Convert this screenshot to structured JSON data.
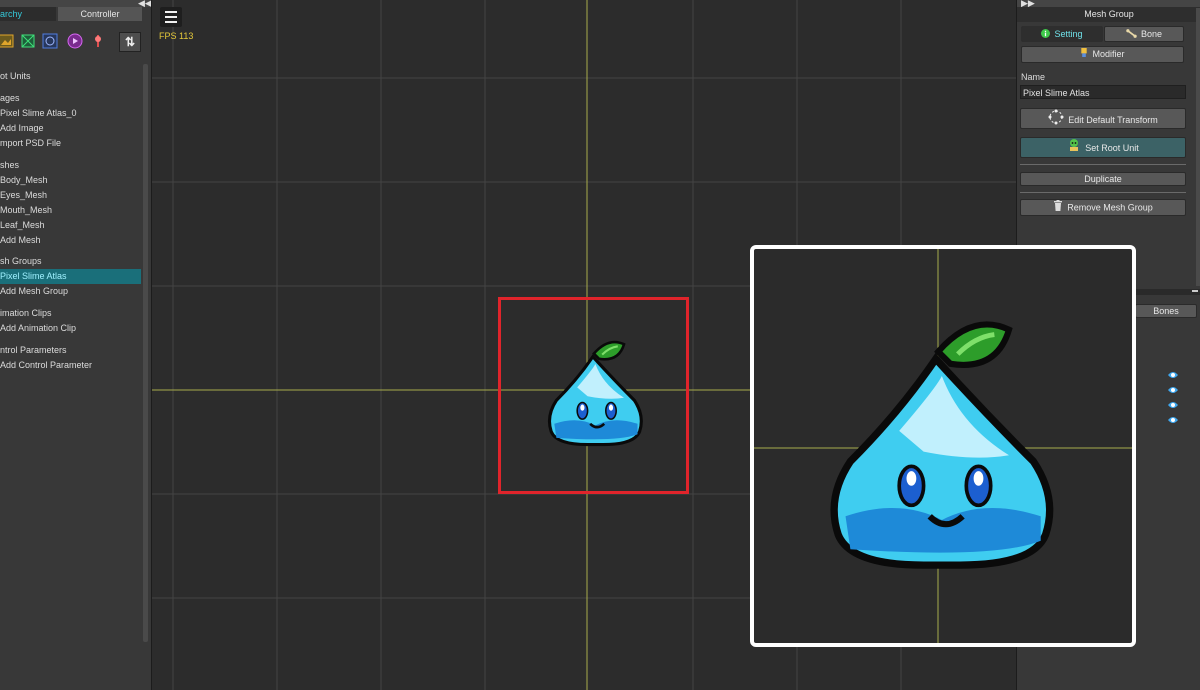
{
  "hierarchy_panel": {
    "tabs": [
      "erarchy",
      "Controller"
    ],
    "sort_button": "⇅",
    "items": [
      {
        "label": "ot Units",
        "selected": false
      },
      {
        "label": "ages",
        "selected": false
      },
      {
        "label": "Pixel Slime Atlas_0",
        "selected": false
      },
      {
        "label": "Add Image",
        "selected": false
      },
      {
        "label": "mport PSD File",
        "selected": false
      },
      {
        "label": "shes",
        "selected": false
      },
      {
        "label": "Body_Mesh",
        "selected": false
      },
      {
        "label": "Eyes_Mesh",
        "selected": false
      },
      {
        "label": "Mouth_Mesh",
        "selected": false
      },
      {
        "label": "Leaf_Mesh",
        "selected": false
      },
      {
        "label": "Add Mesh",
        "selected": false
      },
      {
        "label": "sh Groups",
        "selected": false
      },
      {
        "label": "Pixel Slime Atlas",
        "selected": true
      },
      {
        "label": "Add Mesh Group",
        "selected": false
      },
      {
        "label": "imation Clips",
        "selected": false
      },
      {
        "label": "Add Animation Clip",
        "selected": false
      },
      {
        "label": "ntrol Parameters",
        "selected": false
      },
      {
        "label": "Add Control Parameter",
        "selected": false
      }
    ]
  },
  "viewport": {
    "fps": "FPS 113"
  },
  "inspector": {
    "title": "Mesh Group",
    "tab_setting": "Setting",
    "tab_bone": "Bone",
    "modifier": "Modifier",
    "name_label": "Name",
    "name_value": "Pixel Slime Atlas",
    "edit_default_transform": "Edit Default Transform",
    "set_root_unit": "Set Root Unit",
    "duplicate": "Duplicate",
    "remove_mesh_group": "Remove Mesh Group",
    "bones_tab": "Bones"
  },
  "colors": {
    "selection": "#1a6f7a",
    "accent_text": "#35c9d9",
    "fps_text": "#e5c93a",
    "highlight_box": "#e0242b",
    "axis_line": "#a7ad4c"
  }
}
